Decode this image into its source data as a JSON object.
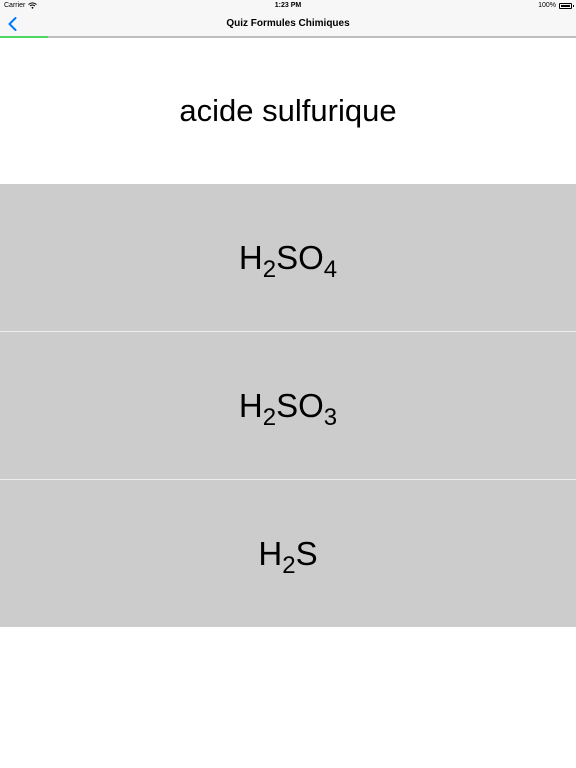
{
  "status_bar": {
    "carrier": "Carrier",
    "time": "1:23 PM",
    "battery": "100%",
    "icons": [
      "wifi-icon",
      "battery-icon"
    ]
  },
  "nav": {
    "title": "Quiz Formules Chimiques",
    "back_icon": "chevron-left-icon",
    "accent_color": "#007aff"
  },
  "progress": {
    "fraction": 0.083,
    "color": "#4cd964"
  },
  "question": {
    "text": "acide sulfurique"
  },
  "answers": [
    {
      "parts": [
        {
          "t": "H"
        },
        {
          "sub": "2"
        },
        {
          "t": "SO"
        },
        {
          "sub": "4"
        }
      ]
    },
    {
      "parts": [
        {
          "t": "H"
        },
        {
          "sub": "2"
        },
        {
          "t": "SO"
        },
        {
          "sub": "3"
        }
      ]
    },
    {
      "parts": [
        {
          "t": "H"
        },
        {
          "sub": "2"
        },
        {
          "t": "S"
        }
      ]
    }
  ]
}
